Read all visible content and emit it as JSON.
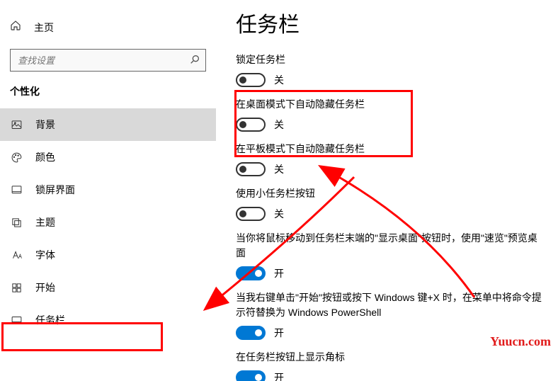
{
  "sidebar": {
    "home": "主页",
    "search_placeholder": "查找设置",
    "section": "个性化",
    "items": [
      {
        "label": "背景"
      },
      {
        "label": "颜色"
      },
      {
        "label": "锁屏界面"
      },
      {
        "label": "主题"
      },
      {
        "label": "字体"
      },
      {
        "label": "开始"
      },
      {
        "label": "任务栏"
      }
    ]
  },
  "main": {
    "title": "任务栏",
    "settings": [
      {
        "label": "锁定任务栏",
        "state": "off",
        "text": "关"
      },
      {
        "label": "在桌面模式下自动隐藏任务栏",
        "state": "off",
        "text": "关"
      },
      {
        "label": "在平板模式下自动隐藏任务栏",
        "state": "off",
        "text": "关"
      },
      {
        "label": "使用小任务栏按钮",
        "state": "off",
        "text": "关"
      },
      {
        "label": "当你将鼠标移动到任务栏末端的\"显示桌面\"按钮时，使用\"速览\"预览桌面",
        "state": "on",
        "text": "开"
      },
      {
        "label": "当我右键单击\"开始\"按钮或按下 Windows 键+X 时，在菜单中将命令提示符替换为 Windows PowerShell",
        "state": "on",
        "text": "开"
      },
      {
        "label": "在任务栏按钮上显示角标",
        "state": "on",
        "text": "开"
      }
    ]
  },
  "watermark": "Yuucn.com"
}
